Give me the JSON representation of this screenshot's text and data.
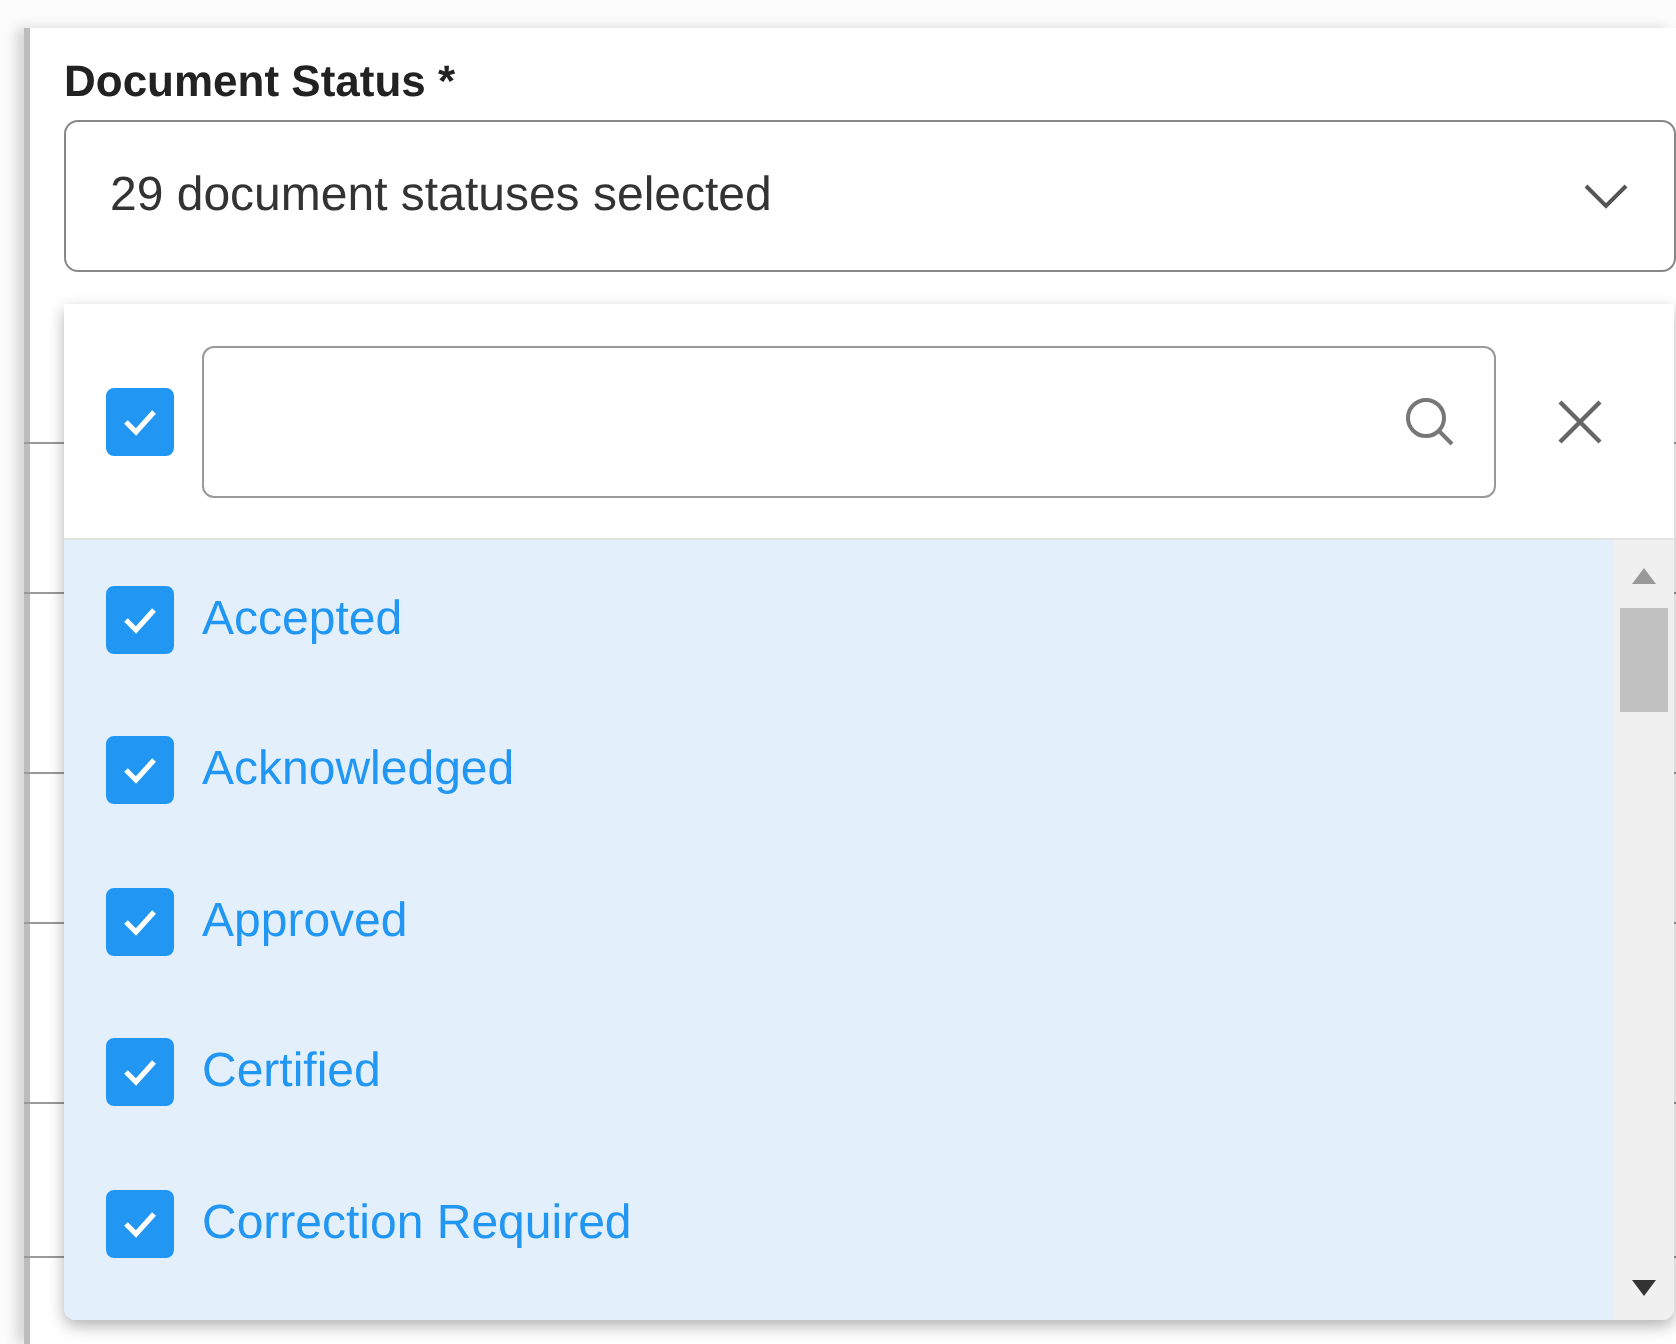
{
  "field": {
    "label": "Document Status *",
    "value": "29 document statuses selected",
    "expanded": true
  },
  "dropdown": {
    "select_all": {
      "checked": true
    },
    "options": [
      {
        "label": "Accepted",
        "checked": true
      },
      {
        "label": "Acknowledged",
        "checked": true
      },
      {
        "label": "Approved",
        "checked": true
      },
      {
        "label": "Certified",
        "checked": true
      },
      {
        "label": "Correction Required",
        "checked": true
      }
    ]
  }
}
